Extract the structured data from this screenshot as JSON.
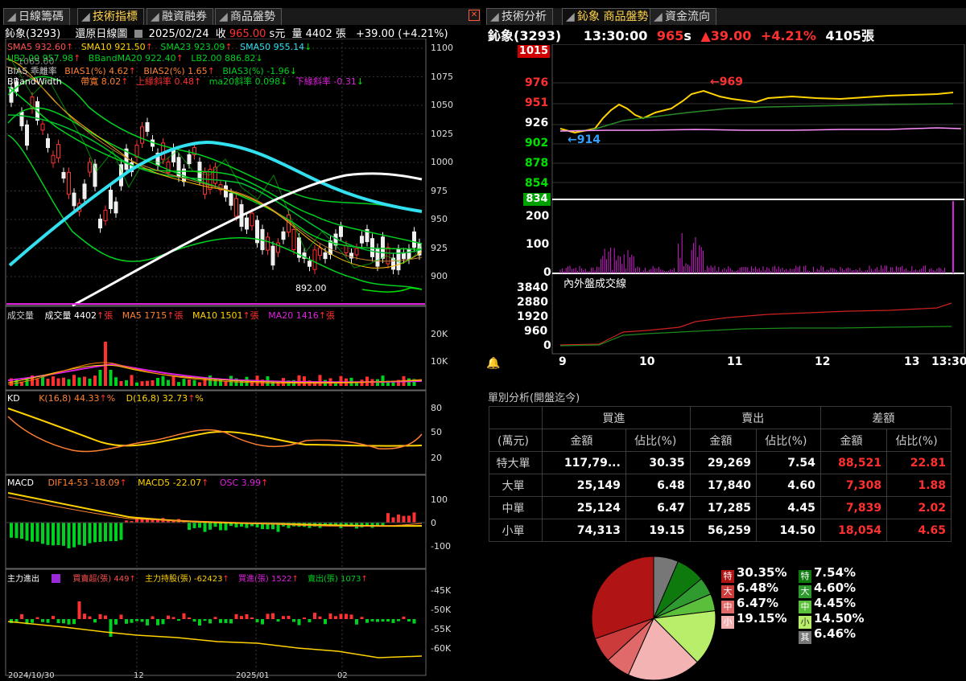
{
  "left_tabs": [
    "日線籌碼",
    "技術指標",
    "融資融券",
    "商品盤勢"
  ],
  "left_active": 1,
  "right_tabs": [
    "技術分析",
    "鈊象 商品盤勢",
    "資金流向"
  ],
  "right_active": 1,
  "stock": "鈊象(3293)",
  "chart_mode": "還原日線圖",
  "date": "2025/02/24",
  "close_label": "收",
  "close": "965.00",
  "close_unit": "s元",
  "volume_label": "量",
  "volume": "4402",
  "volume_unit": "張",
  "change": "+39.00 (+4.21%)",
  "ind": {
    "sma5": "SMA5 932.60",
    "sma10": "SMA10 921.50",
    "sma23": "SMA23 923.09",
    "sma50": "SMA50 955.14",
    "ub2": "UB2.00 957.98",
    "bband": "BBandMA20 922.40",
    "lb2": "LB2.00 886.82",
    "bias_label": "BIAS 乖離率",
    "bias1": "BIAS1(%) 4.62",
    "bias2": "BIAS2(%) 1.65",
    "bias3": "BIAS3(%) -1.96",
    "bw_label": "BBandWidth",
    "bw1": "帶寬 8.02",
    "bw2": "上緣斜率 0.48",
    "bw3": "ma20斜率 0.098",
    "bw4": "下緣斜率 -0.31",
    "ghost": "1065.00"
  },
  "price_axis": [
    "1100",
    "1075",
    "1050",
    "1025",
    "1000",
    "975",
    "950",
    "925",
    "900"
  ],
  "low_label": "892.00",
  "vol_panel": {
    "title": "成交量",
    "vol": "成交量 4402",
    "ma5": "MA5 1715",
    "ma10": "MA10 1501",
    "ma20": "MA20 1416",
    "unit": "張",
    "axis": [
      "20K",
      "10K"
    ]
  },
  "kd_panel": {
    "title": "KD",
    "k": "K(16,8) 44.33",
    "d": "D(16,8) 32.73",
    "pct": "%",
    "axis": [
      "80",
      "50",
      "20"
    ]
  },
  "macd_panel": {
    "title": "MACD",
    "dif": "DIF14-53 -18.09",
    "macd": "MACD5 -22.07",
    "osc": "OSC 3.99",
    "axis": [
      "100",
      "0",
      "-100"
    ]
  },
  "main_panel": {
    "title": "主力進出",
    "buy_sell": "買賣超(張) 449",
    "hold": "主力持股(張) -62423",
    "buy": "買進(張) 1522",
    "sell": "賣出(張) 1073",
    "axis": [
      "-45K",
      "-50K",
      "-55K",
      "-60K"
    ]
  },
  "x_axis": [
    "2024/10/30",
    "12",
    "2025/01",
    "02"
  ],
  "rt": {
    "stock": "鈊象(3293)",
    "time": "13:30:00",
    "price": "965",
    "price_unit": "s",
    "change": "▲39.00",
    "pct": "+4.21%",
    "vol": "4105張",
    "axis_top": "1015",
    "axis": [
      "976",
      "951",
      "926",
      "902",
      "878",
      "854"
    ],
    "axis_bottom": "834",
    "high_mark": "←969",
    "low_mark": "←914",
    "vol_axis": [
      "200",
      "100",
      "0"
    ],
    "inout_title": "內外盤成交線",
    "inout_axis": [
      "3840",
      "2880",
      "1920",
      "960",
      "0"
    ],
    "time_axis": [
      "9",
      "10",
      "11",
      "12",
      "13",
      "13:30"
    ]
  },
  "orders": {
    "title": "單別分析(開盤迄今)",
    "groups": [
      "買進",
      "賣出",
      "差額"
    ],
    "unit": "(萬元)",
    "cols": [
      "金額",
      "佔比(%)",
      "金額",
      "佔比(%)",
      "金額",
      "佔比(%)"
    ],
    "rows": [
      [
        "特大單",
        "117,79...",
        "30.35",
        "29,269",
        "7.54",
        "88,521",
        "22.81"
      ],
      [
        "大單",
        "25,149",
        "6.48",
        "17,840",
        "4.60",
        "7,308",
        "1.88"
      ],
      [
        "中單",
        "25,124",
        "6.47",
        "17,285",
        "4.45",
        "7,839",
        "2.02"
      ],
      [
        "小單",
        "74,313",
        "19.15",
        "56,259",
        "14.50",
        "18,054",
        "4.65"
      ]
    ]
  },
  "pie_legend": {
    "buy": [
      {
        "tag": "特",
        "pct": "30.35%"
      },
      {
        "tag": "大",
        "pct": "6.48%"
      },
      {
        "tag": "中",
        "pct": "6.47%"
      },
      {
        "tag": "小",
        "pct": "19.15%"
      }
    ],
    "sell": [
      {
        "tag": "特",
        "pct": "7.54%"
      },
      {
        "tag": "大",
        "pct": "4.60%"
      },
      {
        "tag": "中",
        "pct": "4.45%"
      },
      {
        "tag": "小",
        "pct": "14.50%"
      },
      {
        "tag": "其",
        "pct": "6.46%"
      }
    ]
  },
  "chart_data": {
    "type": "pie",
    "labels": [
      "特",
      "大",
      "中",
      "小",
      "特",
      "大",
      "中",
      "小",
      "其"
    ],
    "values": [
      30.35,
      6.48,
      6.47,
      19.15,
      7.54,
      4.6,
      4.45,
      14.5,
      6.46
    ],
    "colors": [
      "#b01414",
      "#cc3b3b",
      "#e06a6a",
      "#f4b3b3",
      "#0e7a0e",
      "#2f9a2f",
      "#5cbf3c",
      "#b8ee6a",
      "#777777"
    ]
  },
  "colors": {
    "up": "#ff3030",
    "down": "#00e000",
    "tab_active": "#ffd24a",
    "sma50": "#33e0f0",
    "bband": "#00d020"
  }
}
